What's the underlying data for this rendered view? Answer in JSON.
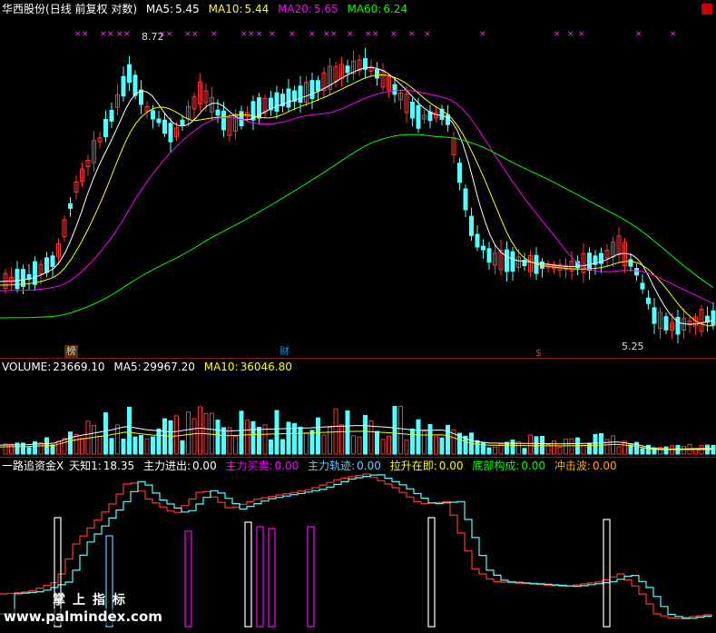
{
  "price_panel": {
    "stock_name": "华西股份",
    "period": "(日线 前复权 对数)",
    "ma5": {
      "label": "MA5:",
      "value": "5.45",
      "color": "#ffffff"
    },
    "ma10": {
      "label": "MA10:",
      "value": "5.44",
      "color": "#ffff00"
    },
    "ma20": {
      "label": "MA20:",
      "value": "5.65",
      "color": "#ff00ff"
    },
    "ma60": {
      "label": "MA60:",
      "value": "6.24",
      "color": "#00ff00"
    },
    "high_label": "8.72",
    "low_label": "5.25",
    "tags": [
      {
        "text": "榜",
        "color": "#ffaa00"
      },
      {
        "text": "财",
        "color": "#00aaff"
      },
      {
        "text": "$",
        "color": "#ff2020"
      }
    ],
    "signal_marks": "×"
  },
  "volume_panel": {
    "label": "VOLUME:",
    "value": "23669.10",
    "ma5_label": "MA5:",
    "ma5_value": "29967.20",
    "ma10_label": "MA10:",
    "ma10_value": "36046.80"
  },
  "indicator_panel": {
    "name": "一路追资金X",
    "items": [
      {
        "label": "天知1:",
        "value": "18.35",
        "color": "#ffffff"
      },
      {
        "label": "主力进出:",
        "value": "0.00",
        "color": "#ffffff"
      },
      {
        "label": "主力买卖:",
        "value": "0.00",
        "color": "#ff00ff"
      },
      {
        "label": "主力轨迹:",
        "value": "0.00",
        "color": "#66ccff"
      },
      {
        "label": "拉升在即:",
        "value": "0.00",
        "color": "#ffff00"
      },
      {
        "label": "底部构成:",
        "value": "0.00",
        "color": "#00ff00"
      },
      {
        "label": "冲击波:",
        "value": "0.00",
        "color": "#ffaa00"
      }
    ]
  },
  "watermark": {
    "top": "掌上指标",
    "bottom": "www.palmindex.com"
  },
  "colors": {
    "up": "#ff3333",
    "down": "#54ffff",
    "border": "#8b1a1a"
  }
}
